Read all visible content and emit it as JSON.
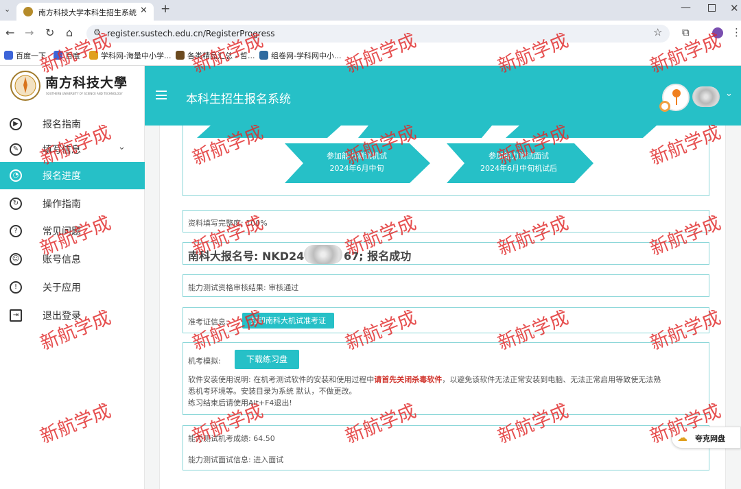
{
  "browser": {
    "tab_title": "南方科技大学本科生招生系统",
    "url": "register.sustech.edu.cn/RegisterProgress",
    "bookmarks": [
      "百度一下",
      "百度",
      "学科网-海量中小学...",
      "各类精品汇总 - 哲...",
      "组卷网-学科网中小..."
    ]
  },
  "logo": {
    "name": "南方科技大學",
    "subtitle": "SOUTHERN UNIVERSITY OF SCIENCE AND TECHNOLOGY"
  },
  "header": {
    "title": "本科生招生报名系统"
  },
  "sidebar": {
    "items": [
      {
        "label": "报名指南",
        "icon": "play-circle-icon"
      },
      {
        "label": "填写信息",
        "icon": "edit-icon"
      },
      {
        "label": "报名进度",
        "icon": "gauge-icon"
      },
      {
        "label": "操作指南",
        "icon": "refresh-icon"
      },
      {
        "label": "常见问题",
        "icon": "question-icon"
      },
      {
        "label": "账号信息",
        "icon": "user-circle-icon"
      },
      {
        "label": "关于应用",
        "icon": "info-icon"
      },
      {
        "label": "退出登录",
        "icon": "logout-icon"
      }
    ]
  },
  "progress": {
    "steps": [
      {
        "title": "参加能力测试机试",
        "date": "2024年6月中旬"
      },
      {
        "title": "参加能力测试面试",
        "date": "2024年6月中旬机试后"
      }
    ]
  },
  "completion": {
    "label": "资料填写完整度: 100%"
  },
  "registration": {
    "text": "南科大报名号: NKD24",
    "suffix": "67; 报名成功"
  },
  "review": {
    "text": "能力测试资格审核结果: 审核通过"
  },
  "ticket": {
    "label": "准考证信息:",
    "button": "打印南科大机试准考证"
  },
  "mock": {
    "label": "机考模拟:",
    "button": "下载练习盘",
    "note_prefix": "软件安装使用说明: 在机考测试软件的安装和使用过程中",
    "note_highlight": "请首先关闭杀毒软件",
    "note_suffix": "，以避免该软件无法正常安装到电脑、无法正常启用等致使无法熟",
    "note_line2": "悉机考环境等。安装目录为系统 默认，不做更改。",
    "note_line3": "练习结束后请使用Alt+F4退出!"
  },
  "results": {
    "score": "能力测试机考成绩: 64.50",
    "interview": "能力测试面试信息: 进入面试"
  },
  "float": {
    "label": "夸克网盘"
  },
  "watermark": {
    "text": "新航学成"
  },
  "colors": {
    "accent": "#26c0c7",
    "border": "#8ad6d8",
    "highlight": "#d0342c"
  }
}
